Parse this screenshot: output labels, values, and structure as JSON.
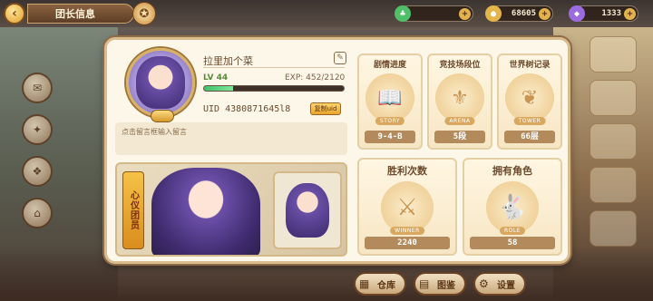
{
  "header": {
    "title": "团长信息",
    "back_icon": "back-arrow-icon",
    "emblem_icon": "crest-icon"
  },
  "resources": [
    {
      "name": "stamina",
      "value": "",
      "icon": "stamina-icon",
      "color": "#4fbf6a"
    },
    {
      "name": "coins",
      "value": "68605",
      "icon": "coin-icon",
      "color": "#e4b54a"
    },
    {
      "name": "gems",
      "value": "1333",
      "icon": "gem-icon",
      "color": "#9c6be0"
    }
  ],
  "profile": {
    "name": "拉里加个菜",
    "level": "LV 44",
    "exp": "EXP: 452/2120",
    "exp_progress": 0.21,
    "uid": "UID 4380871645l8",
    "copy_label": "复制uid",
    "message_placeholder": "点击留言框输入留言",
    "avatar_icon": "avatar-portrait-icon"
  },
  "favorite": {
    "label": "心仪团员"
  },
  "stats": {
    "story": {
      "title": "剧情进度",
      "emblem_label": "STORY",
      "value": "9-4-B",
      "icon": "book-icon"
    },
    "arena": {
      "title": "竞技场段位",
      "emblem_label": "ARENA",
      "value": "5段",
      "icon": "arena-crest-icon"
    },
    "tower": {
      "title": "世界树记录",
      "emblem_label": "TOWER",
      "value": "66层",
      "icon": "tree-icon"
    },
    "winner": {
      "title": "胜利次数",
      "emblem_label": "WINNER",
      "value": "2240",
      "icon": "crossed-swords-icon"
    },
    "role": {
      "title": "拥有角色",
      "emblem_label": "ROLE",
      "value": "58",
      "icon": "bunny-icon"
    }
  },
  "bottom_menu": [
    {
      "label": "仓库",
      "icon": "warehouse-icon"
    },
    {
      "label": "图鉴",
      "icon": "codex-icon"
    },
    {
      "label": "设置",
      "icon": "gear-icon"
    }
  ],
  "colors": {
    "panel_bg": "#fdf7ea",
    "panel_border": "#d9bd8e",
    "exp_green": "#3fc36d",
    "value_bar": "#b38a5c"
  }
}
